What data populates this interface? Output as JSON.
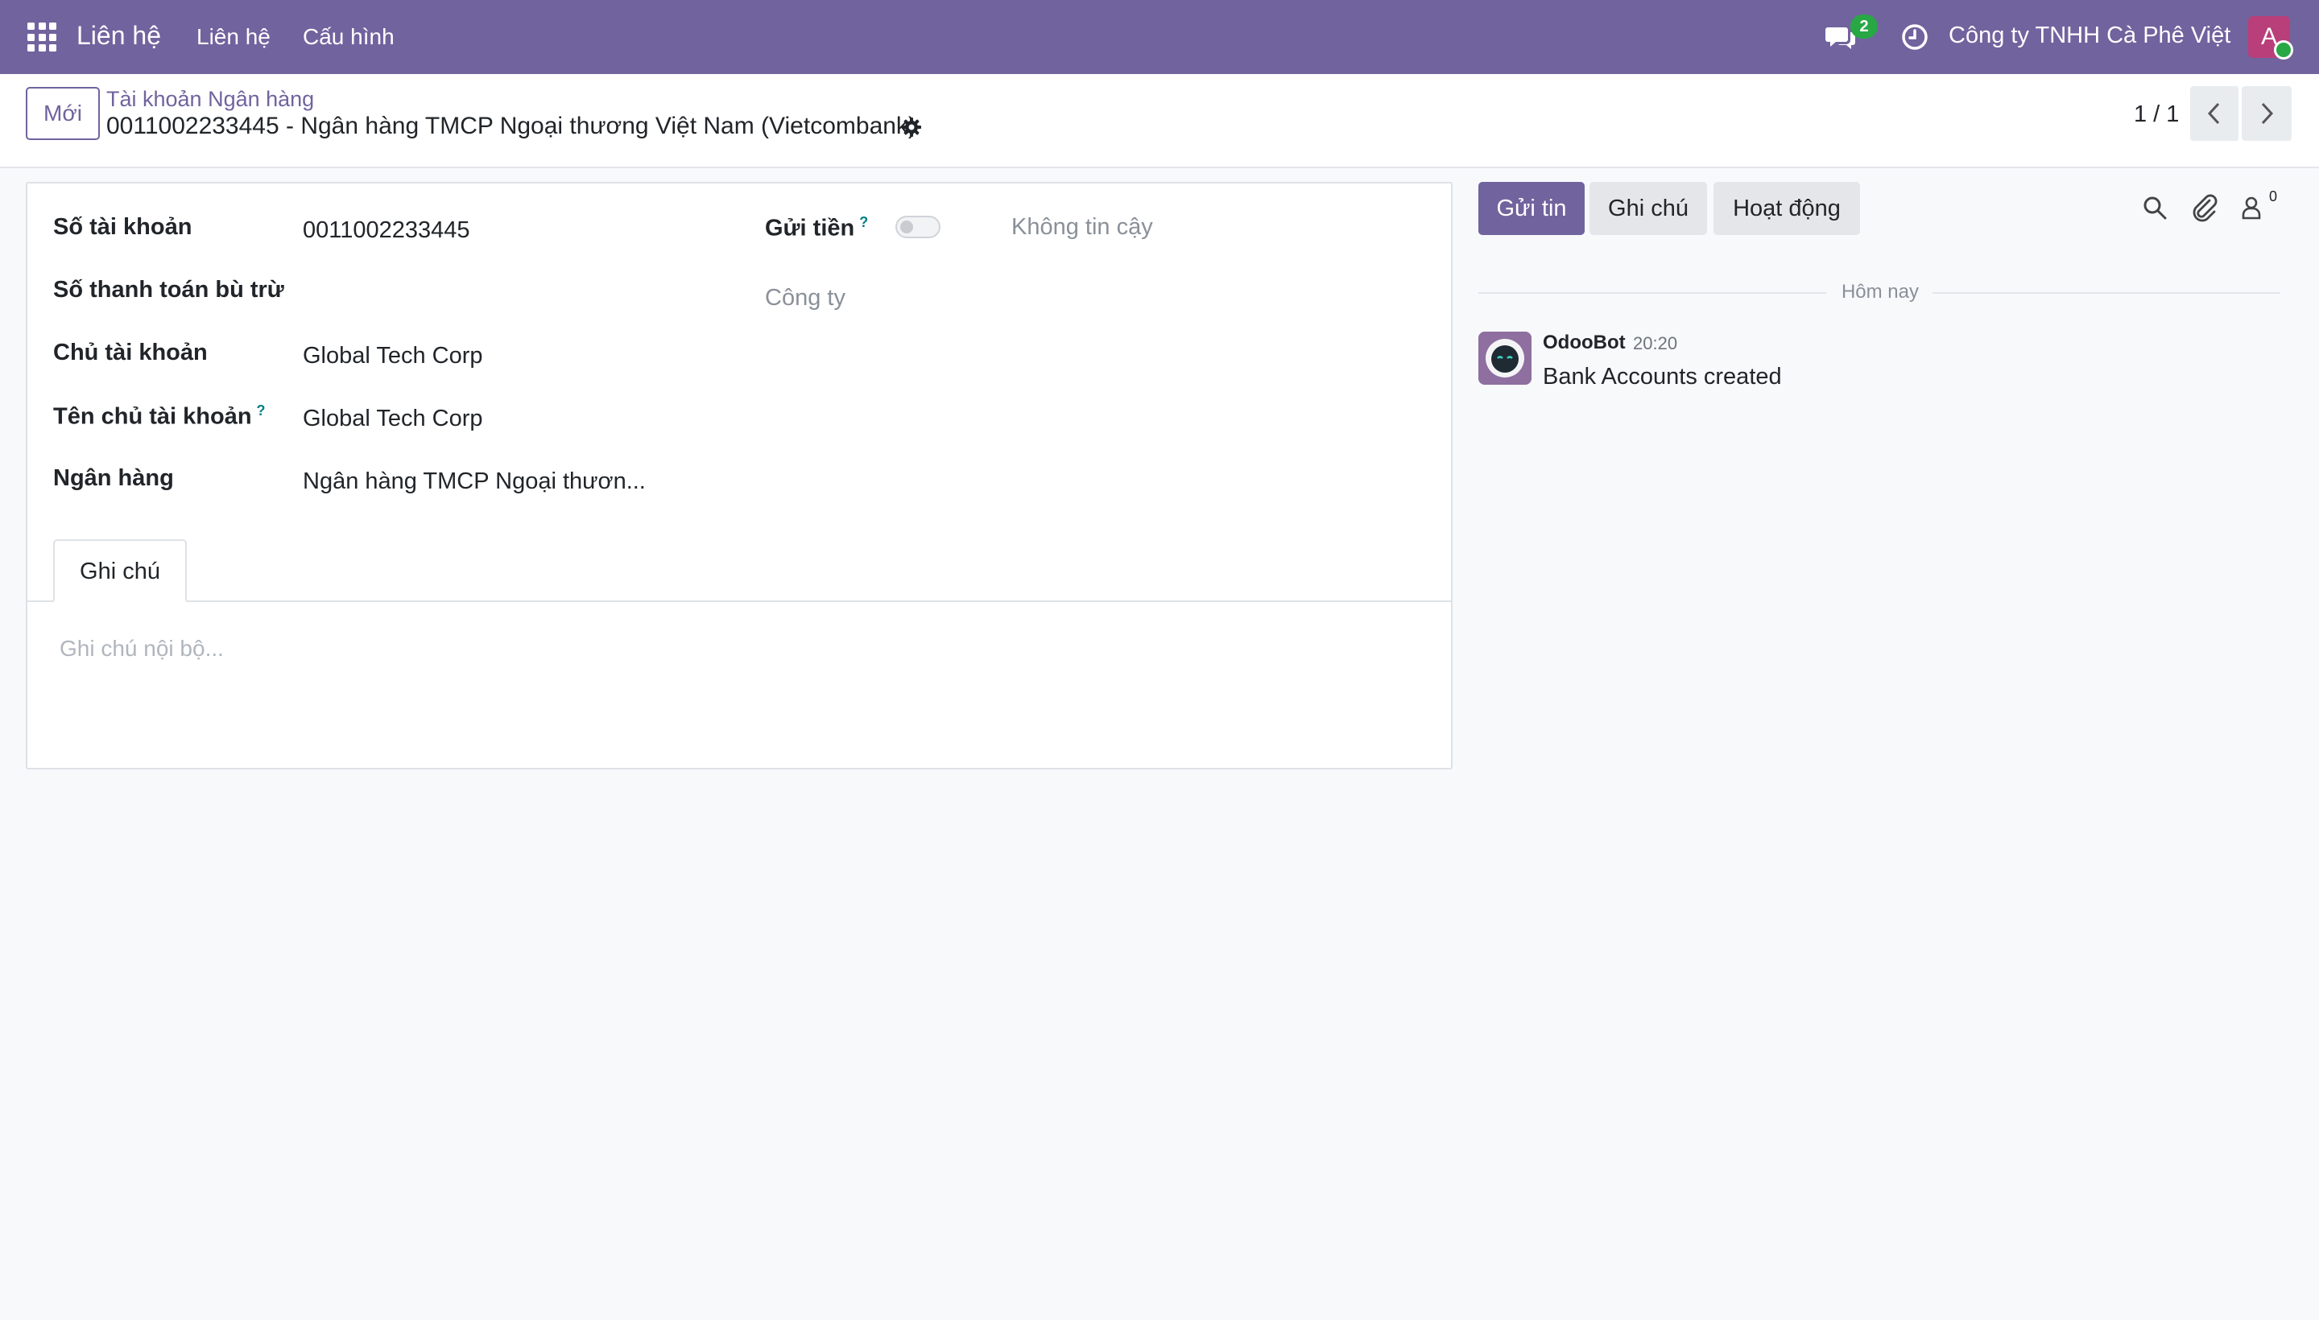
{
  "navbar": {
    "app_name": "Liên hệ",
    "menu": [
      "Liên hệ",
      "Cấu hình"
    ],
    "chat_count": "2",
    "company": "Công ty TNHH Cà Phê Việt",
    "user_initial": "A",
    "colors": {
      "brand": "#71639e",
      "avatar": "#b83f7a",
      "online": "#28a745"
    }
  },
  "control": {
    "new_button": "Mới",
    "breadcrumb": "Tài khoản Ngân hàng",
    "record_title": "0011002233445 - Ngân hàng TMCP Ngoại thương Việt Nam (Vietcombank)",
    "pager": "1 / 1"
  },
  "form": {
    "account_number": {
      "label": "Số tài khoản",
      "value": "0011002233445"
    },
    "clearing_number": {
      "label": "Số thanh toán bù trừ",
      "value": ""
    },
    "holder": {
      "label": "Chủ tài khoản",
      "value": "Global Tech Corp"
    },
    "holder_name": {
      "label": "Tên chủ tài khoản",
      "help": "?",
      "value": "Global Tech Corp"
    },
    "bank": {
      "label": "Ngân hàng",
      "value": "Ngân hàng TMCP Ngoại thươn..."
    },
    "send_money": {
      "label": "Gửi tiền",
      "help": "?",
      "enabled": false,
      "status": "Không tin cậy"
    },
    "company": {
      "placeholder": "Công ty"
    },
    "tabs": [
      "Ghi chú"
    ],
    "note_placeholder": "Ghi chú nội bộ..."
  },
  "chatter": {
    "buttons": {
      "send": "Gửi tin",
      "note": "Ghi chú",
      "activity": "Hoạt động"
    },
    "follower_count": "0",
    "separator": "Hôm nay",
    "messages": [
      {
        "author": "OdooBot",
        "time": "20:20",
        "body": "Bank Accounts created"
      }
    ]
  }
}
